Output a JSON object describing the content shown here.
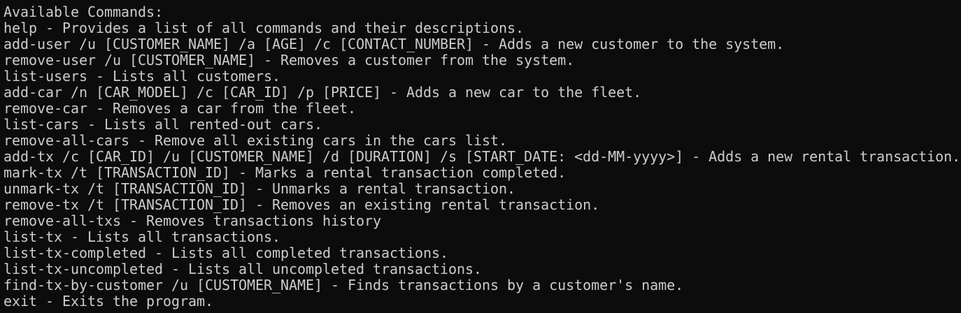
{
  "terminal": {
    "separator": "------------------------------------------------------------",
    "heading": "Available Commands:",
    "commands": [
      "help - Provides a list of all commands and their descriptions.",
      "add-user /u [CUSTOMER_NAME] /a [AGE] /c [CONTACT_NUMBER] - Adds a new customer to the system.",
      "remove-user /u [CUSTOMER_NAME] - Removes a customer from the system.",
      "list-users - Lists all customers.",
      "add-car /n [CAR_MODEL] /c [CAR_ID] /p [PRICE] - Adds a new car to the fleet.",
      "remove-car - Removes a car from the fleet.",
      "list-cars - Lists all rented-out cars.",
      "remove-all-cars - Remove all existing cars in the cars list.",
      "add-tx /c [CAR_ID] /u [CUSTOMER_NAME] /d [DURATION] /s [START_DATE: <dd-MM-yyyy>] - Adds a new rental transaction.",
      "mark-tx /t [TRANSACTION_ID] - Marks a rental transaction completed.",
      "unmark-tx /t [TRANSACTION_ID] - Unmarks a rental transaction.",
      "remove-tx /t [TRANSACTION_ID] - Removes an existing rental transaction.",
      "remove-all-txs - Removes transactions history",
      "list-tx - Lists all transactions.",
      "list-tx-completed - Lists all completed transactions.",
      "list-tx-uncompleted - Lists all uncompleted transactions.",
      "find-tx-by-customer /u [CUSTOMER_NAME] - Finds transactions by a customer's name.",
      "exit - Exits the program."
    ]
  },
  "colors": {
    "background": "#0c0c0c",
    "text": "#cccccc"
  }
}
